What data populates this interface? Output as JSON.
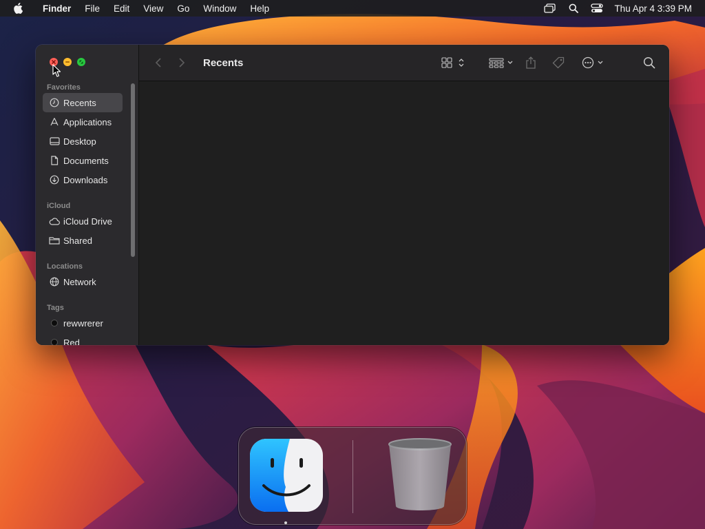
{
  "menubar": {
    "app_name": "Finder",
    "menus": [
      "File",
      "Edit",
      "View",
      "Go",
      "Window",
      "Help"
    ],
    "clock": "Thu Apr 4  3:39 PM",
    "status_icons": [
      "screen-mirroring-icon",
      "spotlight-search-icon",
      "control-center-icon"
    ]
  },
  "window": {
    "title": "Recents",
    "traffic_lights": {
      "close": "#ff5f57",
      "minimize": "#febc2e",
      "maximize": "#28c840"
    },
    "sidebar": {
      "sections": [
        {
          "title": "Favorites",
          "items": [
            {
              "label": "Recents",
              "icon": "clock-icon",
              "selected": true
            },
            {
              "label": "Applications",
              "icon": "applications-icon",
              "selected": false
            },
            {
              "label": "Desktop",
              "icon": "desktop-icon",
              "selected": false
            },
            {
              "label": "Documents",
              "icon": "document-icon",
              "selected": false
            },
            {
              "label": "Downloads",
              "icon": "download-icon",
              "selected": false
            }
          ]
        },
        {
          "title": "iCloud",
          "items": [
            {
              "label": "iCloud Drive",
              "icon": "cloud-icon"
            },
            {
              "label": "Shared",
              "icon": "shared-folder-icon"
            }
          ]
        },
        {
          "title": "Locations",
          "items": [
            {
              "label": "Network",
              "icon": "globe-icon"
            }
          ]
        },
        {
          "title": "Tags",
          "items": [
            {
              "label": "rewwrerer",
              "icon": "tag-dot",
              "color": "#0c0c0c"
            },
            {
              "label": "Red",
              "icon": "tag-dot",
              "color": "#0c0c0c"
            }
          ]
        }
      ]
    },
    "toolbar": {
      "back": "chevron-left-icon",
      "forward": "chevron-right-icon",
      "view_mode": "icon-grid-icon",
      "group": "group-by-icon",
      "share": "share-icon",
      "tags": "tag-icon",
      "more": "ellipsis-circle-icon",
      "search": "search-icon"
    }
  },
  "dock": {
    "apps": [
      {
        "name": "Finder",
        "icon": "finder-icon",
        "running": true
      },
      {
        "name": "Trash",
        "icon": "trash-icon",
        "running": false
      }
    ]
  },
  "colors": {
    "accent": "#0a84ff",
    "sidebar_bg": "#2b2a2d",
    "content_bg": "#1f1f1f",
    "selection": "#47464a"
  }
}
